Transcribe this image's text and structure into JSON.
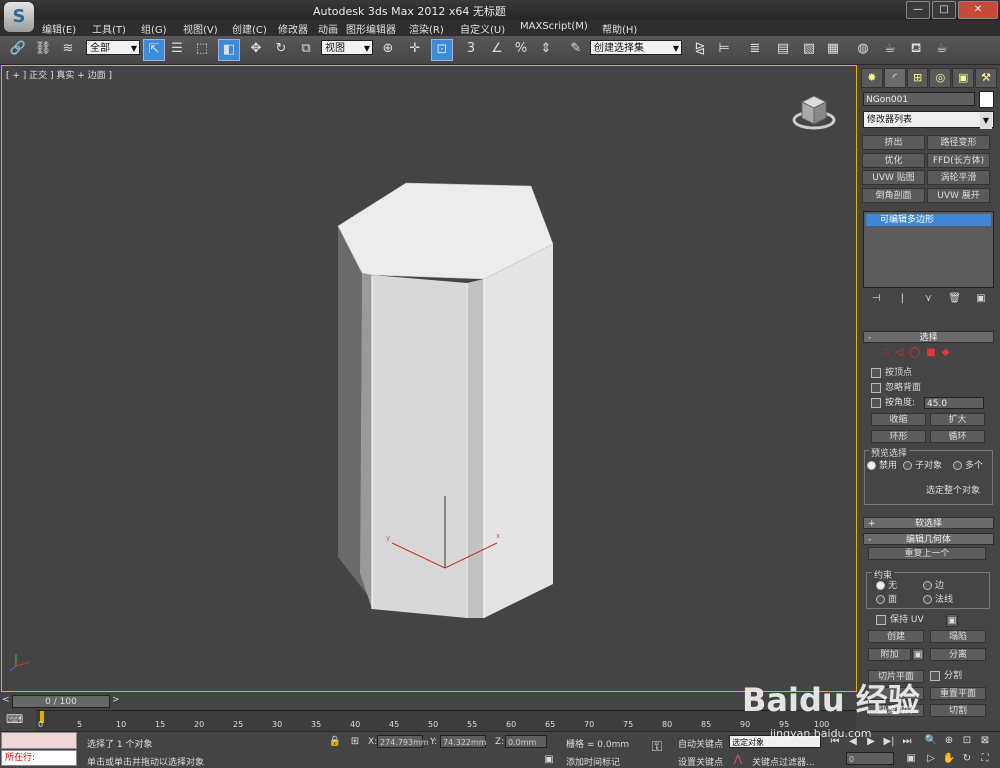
{
  "window": {
    "title": "Autodesk 3ds Max  2012 x64      无标题",
    "logo": "S",
    "minimize": "—",
    "maximize": "□",
    "close": "✕"
  },
  "menu": [
    "编辑(E)",
    "工具(T)",
    "组(G)",
    "视图(V)",
    "创建(C)",
    "修改器",
    "动画",
    "图形编辑器",
    "渲染(R)",
    "自定义(U)",
    "MAXScript(M)",
    "帮助(H)"
  ],
  "toolbar": {
    "filter_value": "全部",
    "ref_coord_value": "视图",
    "selection_set_placeholder": "创建选择集",
    "snap_label": "3",
    "angle_snap_label": "∠",
    "percent_label": "%"
  },
  "viewport": {
    "label": "[ + ] 正交 ] 真实 + 边面 ]",
    "gizmo_z": "z",
    "gizmo_x": "x",
    "gizmo_y": "y"
  },
  "command_panel": {
    "object_name": "NGon001",
    "modifier_list": "修改器列表",
    "modifier_buttons": [
      "挤出",
      "路径变形",
      "优化",
      "FFD(长方体)",
      "UVW 贴图",
      "涡轮平滑",
      "倒角剖面",
      "UVW 展开"
    ],
    "stack_item": "可编辑多边形",
    "selection": {
      "header": "选择",
      "checkboxes": [
        "按顶点",
        "忽略背面",
        "按角度:"
      ],
      "angle_value": "45.0",
      "shrink": "收缩",
      "grow": "扩大",
      "ring": "环形",
      "loop": "循环",
      "preview_label": "预览选择",
      "preview_options": [
        "禁用",
        "子对象",
        "多个"
      ],
      "whole_object": "选定整个对象"
    },
    "soft_selection_header": "软选择",
    "edit_geometry": {
      "header": "编辑几何体",
      "repeat_last": "重复上一个",
      "constraint_label": "约束",
      "constraints": [
        "无",
        "边",
        "面",
        "法线"
      ],
      "preserve_uv": "保持 UV",
      "create": "创建",
      "collapse": "塌陷",
      "attach": "附加",
      "detach": "分离",
      "slice_plane": "切片平面",
      "split": "分割",
      "reset_plane": "重置平面",
      "quickslice": "快速切片",
      "cut": "切割"
    }
  },
  "timeline": {
    "slider": "0 / 100",
    "ticks": [
      "0",
      "5",
      "10",
      "15",
      "20",
      "25",
      "30",
      "35",
      "40",
      "45",
      "50",
      "55",
      "60",
      "65",
      "70",
      "75",
      "80",
      "85",
      "90",
      "95",
      "100"
    ]
  },
  "status": {
    "running": "所在行:",
    "selected": "选择了 1 个对象",
    "prompt": "单击或单击并拖动以选择对象",
    "x_label": "X:",
    "x_value": "274.793mm",
    "y_label": "Y:",
    "y_value": "74.322mm",
    "z_label": "Z:",
    "z_value": "0.0mm",
    "grid": "栅格 = 0.0mm",
    "add_time_tag": "添加时间标记",
    "auto_key": "自动关键点",
    "set_key": "设置关键点",
    "selected_object": "选定对象",
    "key_filters": "关键点过滤器...",
    "frame": "0"
  },
  "watermark": {
    "logo": "Baidu 经验",
    "url": "jingyan.baidu.com"
  }
}
